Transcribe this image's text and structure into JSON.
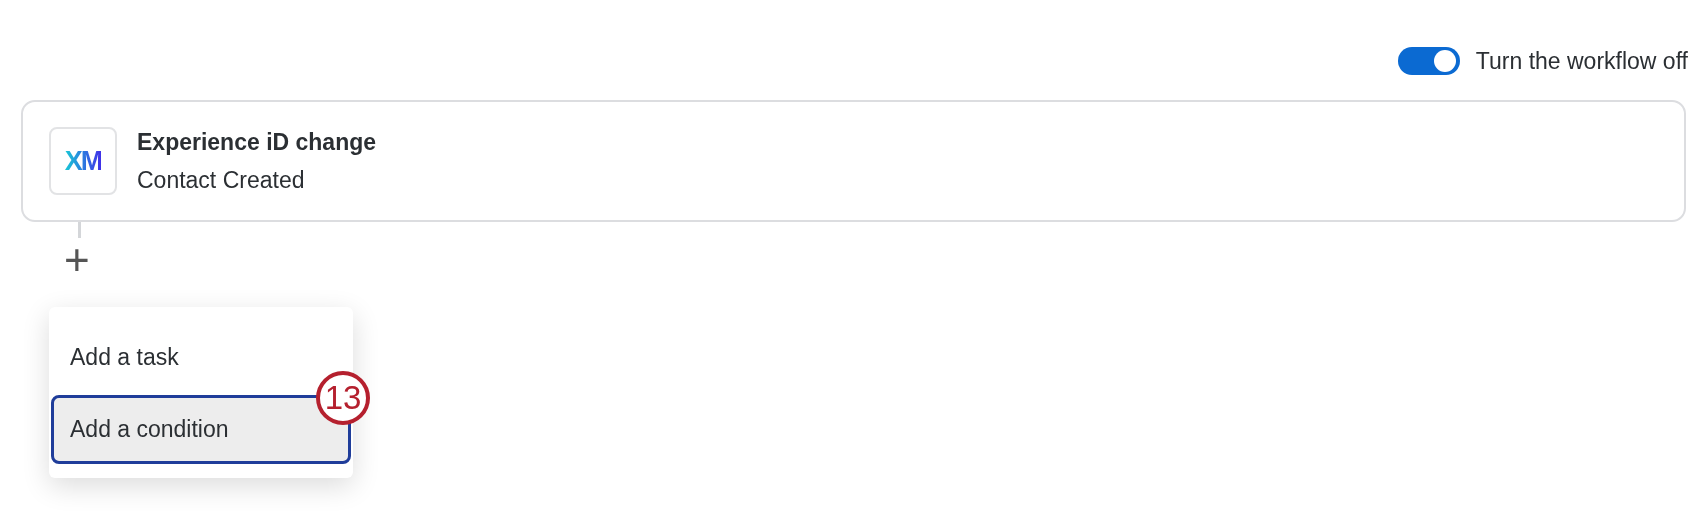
{
  "workflow_toggle": {
    "on": true,
    "label": "Turn the workflow off"
  },
  "event_card": {
    "logo": "XM",
    "title": "Experience iD change",
    "subtitle": "Contact Created"
  },
  "add_button": {
    "symbol": "+"
  },
  "menu": {
    "items": [
      {
        "label": "Add a task",
        "selected": false
      },
      {
        "label": "Add a condition",
        "selected": true
      }
    ]
  },
  "callout": {
    "number": "13"
  }
}
